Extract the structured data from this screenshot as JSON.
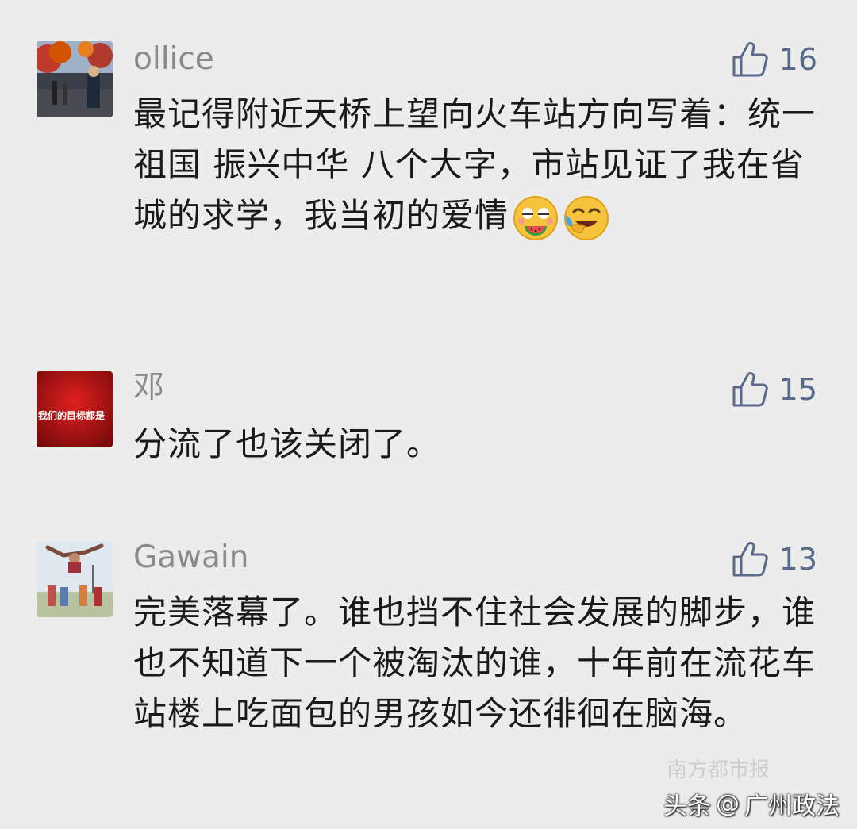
{
  "comments": [
    {
      "username": "ollice",
      "likes": "16",
      "text": "最记得附近天桥上望向火车站方向写着：统一祖国 振兴中华 八个大字，市站见证了我在省城的求学，我当初的爱情",
      "emojis": [
        "watermelon-face-emoji",
        "laughing-tears-emoji"
      ]
    },
    {
      "username": "邓",
      "likes": "15",
      "text": "分流了也该关闭了。",
      "avatar_caption": "我们的目标都是"
    },
    {
      "username": "Gawain",
      "likes": "13",
      "text": "完美落幕了。谁也挡不住社会发展的脚步，谁也不知道下一个被淘汰的谁，十年前在流花车站楼上吃面包的男孩如今还徘徊在脑海。"
    }
  ],
  "watermark": {
    "prefix": "头条",
    "at": "@",
    "account": "广州政法",
    "faded_source": "南方都市报"
  },
  "colors": {
    "background": "#ececec",
    "username": "#8a8a8a",
    "like": "#5a6a8a",
    "text": "#1a1a1a"
  }
}
